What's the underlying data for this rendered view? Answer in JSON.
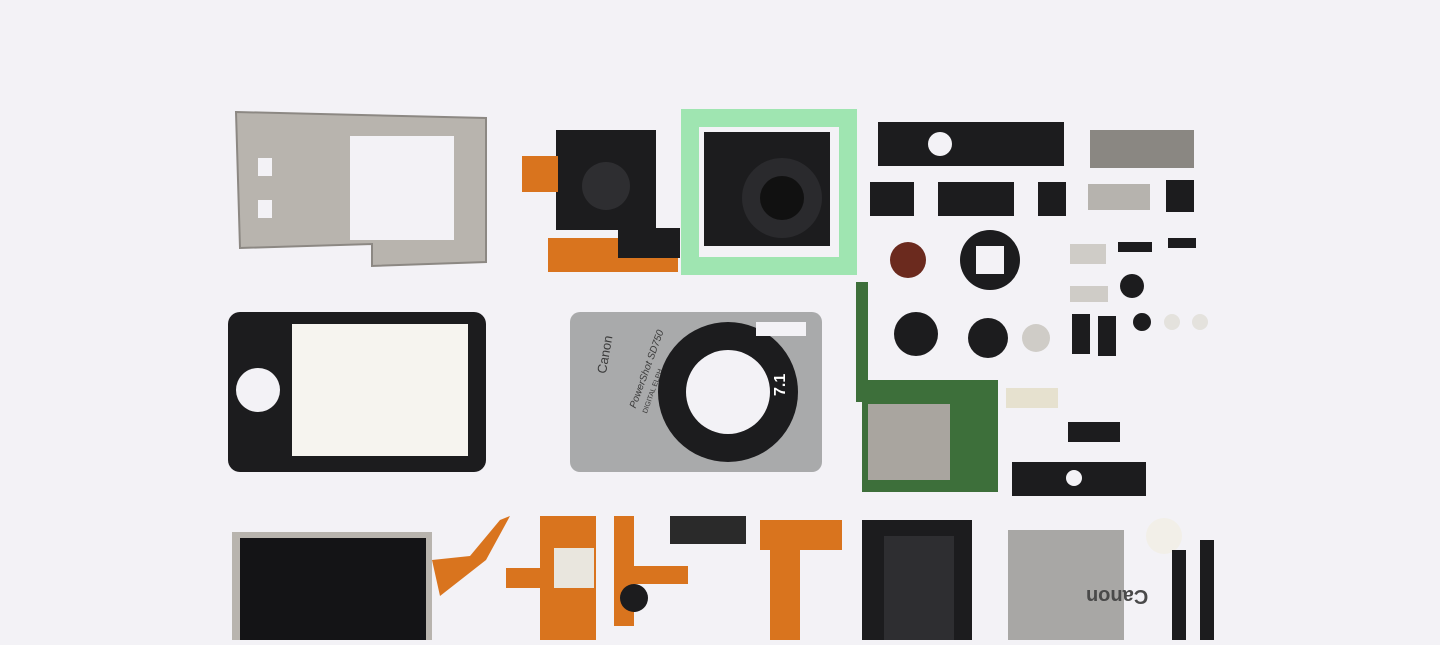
{
  "photo": {
    "background_color": "#f3f2f6",
    "accent_colors": {
      "metal": "#b8b4ae",
      "plastic_black": "#1c1c1e",
      "flex_cable": "#d9741e",
      "pcb_green": "#3d6f3a",
      "tape_green": "#8fe3a4",
      "body_silver": "#a9aaab"
    },
    "printed_text": {
      "front_brand": "Canon",
      "front_model": "PowerShot SD750",
      "front_sub": "DIGITAL ELPH",
      "lens_badge": "7.1",
      "battery_brand": "Canon"
    }
  }
}
